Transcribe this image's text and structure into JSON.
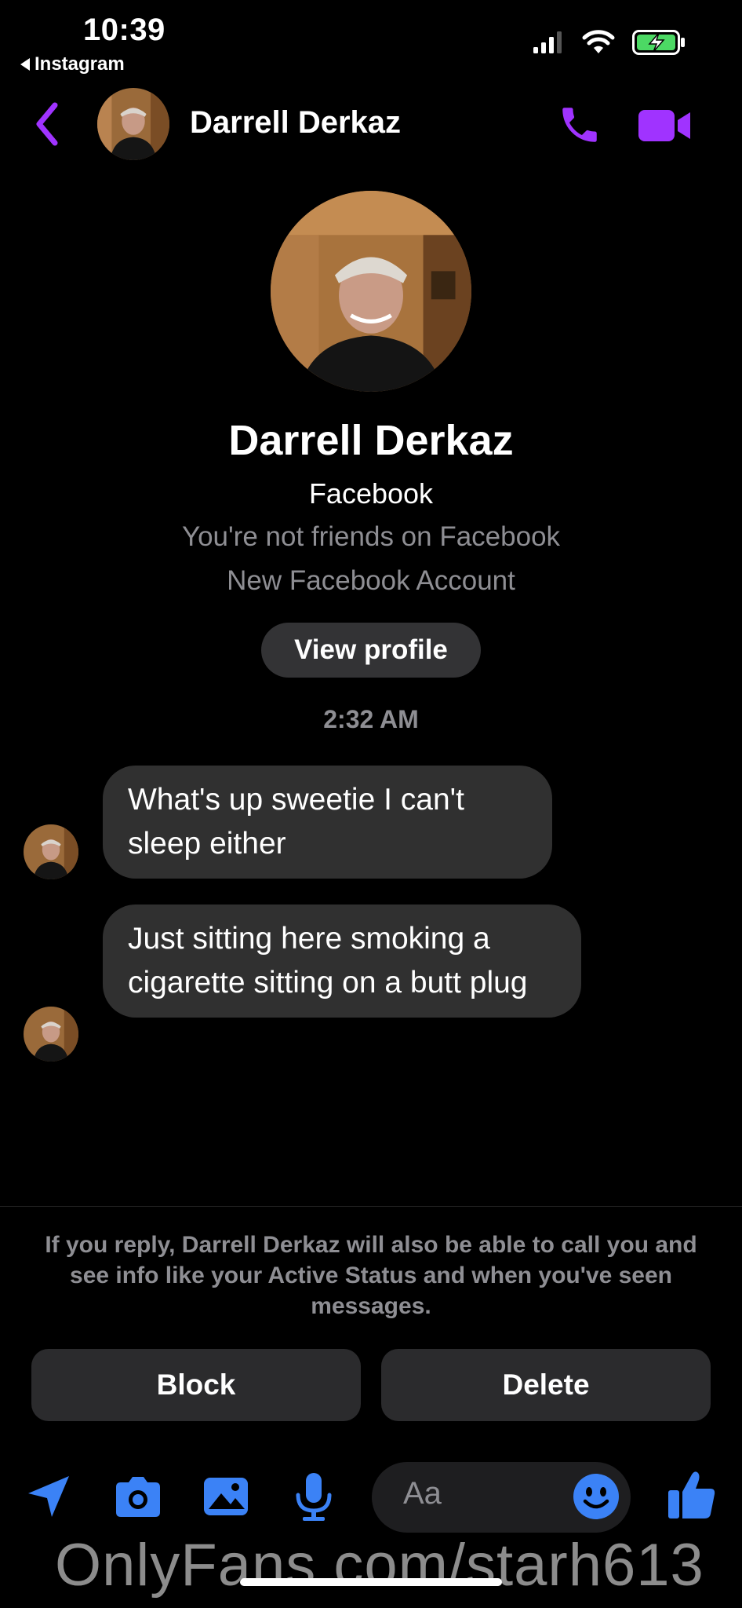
{
  "status_bar": {
    "time": "10:39",
    "back_app": "Instagram"
  },
  "header": {
    "contact_name": "Darrell Derkaz"
  },
  "profile": {
    "name": "Darrell Derkaz",
    "source": "Facebook",
    "friend_status": "You're not friends on Facebook",
    "account_note": "New Facebook Account",
    "view_profile_label": "View profile"
  },
  "conversation": {
    "timestamp": "2:32 AM",
    "messages": [
      {
        "text": "What's up sweetie I can't sleep either"
      },
      {
        "text": "Just sitting here smoking a cigarette sitting on a butt plug"
      }
    ]
  },
  "notice": "If you reply, Darrell Derkaz will also be able to call you and see info like your Active Status and when you've seen messages.",
  "actions": {
    "block_label": "Block",
    "delete_label": "Delete"
  },
  "composer": {
    "placeholder": "Aa"
  },
  "watermark": "OnlyFans.com/starh613",
  "colors": {
    "accent_purple": "#a033ff",
    "composer_blue": "#3b82f6",
    "bubble_bg": "#303030",
    "button_bg": "#2b2b2d"
  },
  "icons": [
    "back-chevron-icon",
    "phone-icon",
    "video-camera-icon",
    "location-arrow-icon",
    "camera-icon",
    "gallery-icon",
    "microphone-icon",
    "emoji-icon",
    "thumbs-up-icon",
    "signal-icon",
    "wifi-icon",
    "battery-icon"
  ]
}
